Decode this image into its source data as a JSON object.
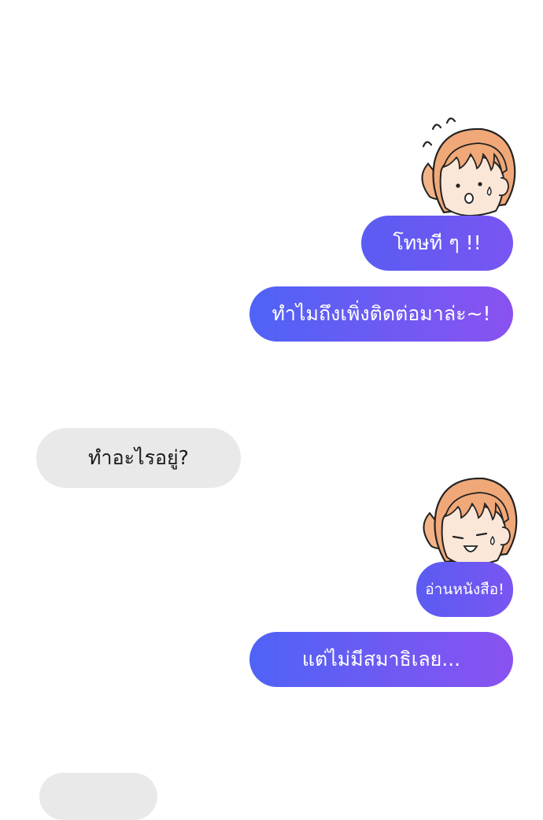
{
  "chat": {
    "messages": [
      {
        "side": "right",
        "text": "โทษที ๆ !!"
      },
      {
        "side": "right",
        "text": "ทำไมถึงเพิ่งติดต่อมาล่ะ~!"
      },
      {
        "side": "left",
        "text": "ทำอะไรอยู่?"
      },
      {
        "side": "right",
        "text": "อ่านหนังสือ!"
      },
      {
        "side": "right",
        "text": "แต่ไม่มีสมาธิเลย..."
      },
      {
        "side": "left",
        "text": ""
      }
    ],
    "avatars": [
      {
        "name": "girl-avatar",
        "expression": "surprised-sweat-icon"
      },
      {
        "name": "girl-avatar",
        "expression": "happy-sweat-icon"
      }
    ],
    "colors": {
      "outgoing_start": "#5a5cf2",
      "outgoing_end": "#7a55f2",
      "incoming": "#e9e9e9",
      "hair": "#f0a878",
      "skin": "#fbe7d8"
    }
  }
}
